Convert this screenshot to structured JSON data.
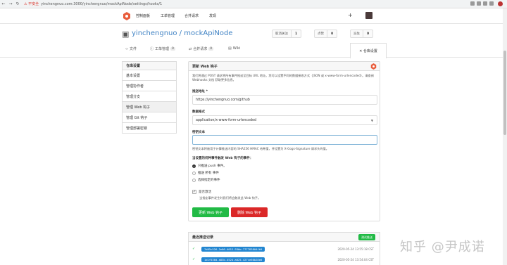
{
  "browser": {
    "insecure_label": "不安全",
    "url": "yinchengnuo.com:3000/yinchengnuo/mockApiNode/settings/hooks/1"
  },
  "topnav": {
    "items": [
      "控制面板",
      "工单管理",
      "合并请求",
      "发现"
    ],
    "plus": "+"
  },
  "repo": {
    "title": "yinchengnuo / mockApiNode",
    "watch_label": "取消关注",
    "watch_count": "1",
    "star_label": "点赞",
    "star_count": "0",
    "fork_label": "派生",
    "fork_count": "0",
    "tabs": [
      {
        "label": "文件",
        "badge": ""
      },
      {
        "label": "工单管理",
        "badge": "0"
      },
      {
        "label": "合并请求",
        "badge": "0"
      },
      {
        "label": "Wiki",
        "badge": ""
      }
    ],
    "settings_tab": "仓库设置"
  },
  "sidebar": {
    "head": "仓库设置",
    "items": [
      "基本设置",
      "管理协作者",
      "管理分支",
      "管理 Web 钩子",
      "管理 Git 钩子",
      "管理部署密钥"
    ]
  },
  "panel": {
    "title": "更新 Web 钩子",
    "desc": "我们将通过 POST 请求将所有事件推送至目标 URL 地址。您可以设置不同的数据接收方式（JSON 或 x-www-form-urlencoded）。请查阅 Webhooks 文档 获取更多信息。",
    "url_label": "推送地址 *",
    "url_value": "https://yinchengnuo.com/github",
    "content_type_label": "数据格式",
    "content_type_value": "application/x-www-form-urlencoded",
    "secret_label": "密钥文本",
    "secret_value": "",
    "secret_help": "密钥文本将被用于计算推送内容的 SHA256 HMAC 哈希值，并设置为 X-Gogs-Signature 请求头的值。",
    "events_label": "当设置的何种事件触发 Web 钩子的事件：",
    "radio_push": "只推送 push 事件。",
    "radio_all": "推送 所有 事件",
    "radio_choose": "选择指定的事件",
    "active_label": "是否激活",
    "active_help": "当指定事件发生时我们将会触发此 Web 钩子。",
    "update_btn": "更新 Web 钩子",
    "delete_btn": "删除 Web 钩子"
  },
  "deliveries": {
    "title": "最近推送记录",
    "test_btn": "测试推送",
    "rows": [
      {
        "uuid": "7d65c526-2e06-4012-93bb-777783804fb5",
        "time": "2020-05-24 13:55:18 CST"
      },
      {
        "uuid": "1d1f536d-a83b-4524-a025-427ce60b28e6",
        "time": "2020-05-24 13:54:04 CST"
      }
    ]
  },
  "watermark": "知乎 @尹成诺",
  "colors": {
    "accent": "#21ba45",
    "danger": "#db2828",
    "link": "#4183c4",
    "label_blue": "#2185d0"
  }
}
